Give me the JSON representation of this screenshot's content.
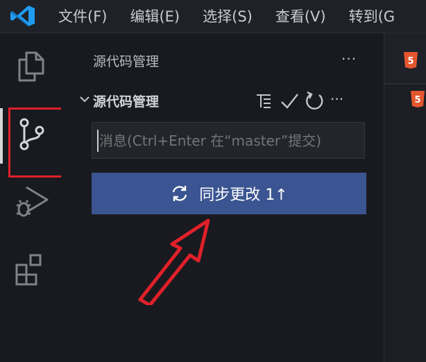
{
  "menu": {
    "items": [
      "文件(F)",
      "编辑(E)",
      "选择(S)",
      "查看(V)",
      "转到(G"
    ]
  },
  "sidebar": {
    "title": "源代码管理",
    "more": "···",
    "scm": {
      "section_title": "源代码管理",
      "commit_placeholder": "消息(Ctrl+Enter 在“master”提交)",
      "sync_button_label": "同步更改 1↑",
      "more": "···"
    }
  },
  "colors": {
    "accent_button": "#3b5592",
    "annotation_red": "#e0202a",
    "logo_blue": "#1f9cf0",
    "html5_orange": "#e4572e"
  },
  "icons": {
    "activity": [
      "explorer-icon",
      "source-control-icon",
      "run-debug-icon",
      "extensions-icon"
    ],
    "scm_toolbar": [
      "view-as-tree-icon",
      "commit-check-icon",
      "refresh-icon",
      "more-icon"
    ]
  }
}
